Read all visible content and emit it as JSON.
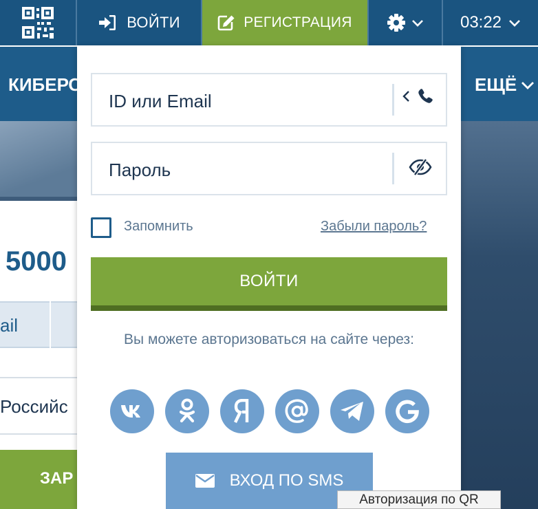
{
  "topbar": {
    "qr_icon": "qr-code-icon",
    "login_label": "ВОЙТИ",
    "login_icon": "sign-in-icon",
    "register_label": "РЕГИСТРАЦИЯ",
    "register_icon": "edit-icon",
    "settings_icon": "gear-icon",
    "time": "03:22"
  },
  "nav": {
    "left_item": "КИБЕРС",
    "more_label": "ЕЩЁ"
  },
  "background": {
    "amount": "5000",
    "mail_text": "ail",
    "country_text": "Российс",
    "green_button_text": "ЗАР"
  },
  "login_panel": {
    "login_field_placeholder": "ID или Email",
    "password_field_placeholder": "Пароль",
    "remember_label": "Запомнить",
    "remember_checked": false,
    "forgot_link": "Забыли пароль?",
    "submit_label": "ВОЙТИ",
    "alt_auth_text": "Вы можете авторизоваться на сайте через:",
    "socials": [
      {
        "name": "vk",
        "icon": "vk-icon"
      },
      {
        "name": "odnoklassniki",
        "icon": "odnoklassniki-icon"
      },
      {
        "name": "yandex",
        "icon": "yandex-icon"
      },
      {
        "name": "mail",
        "icon": "at-icon"
      },
      {
        "name": "telegram",
        "icon": "telegram-icon"
      },
      {
        "name": "google",
        "icon": "google-icon"
      }
    ],
    "sms_button_label": "ВХОД ПО SMS"
  },
  "tooltip": {
    "text": "Авторизация по QR"
  },
  "colors": {
    "header_blue": "#1a5480",
    "nav_blue": "#1e5c8a",
    "accent_green": "#7da63c",
    "social_blue": "#6f9fce",
    "text_dark": "#1e3550",
    "text_muted": "#5b7690"
  }
}
